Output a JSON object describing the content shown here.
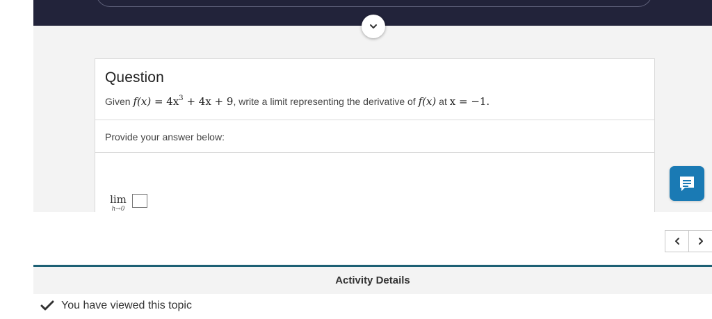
{
  "question": {
    "heading": "Question",
    "text_prefix": "Given",
    "func_name": "f(x)",
    "equals": " = 4x",
    "exponent": "3",
    "func_rest": " + 4x + 9",
    "text_middle": ", write a limit representing the derivative of",
    "func_ref": "f(x)",
    "text_at": "at",
    "point": "x = −1."
  },
  "answer": {
    "prompt": "Provide your answer below:",
    "lim_word": "lim",
    "lim_sub": "h→0"
  },
  "activity_details": {
    "title": "Activity Details",
    "viewed_text": "You have viewed this topic"
  },
  "icons": {
    "collapse": "chevron-down-icon",
    "chat": "chat-icon",
    "prev": "chevron-left-icon",
    "next": "chevron-right-icon",
    "check": "checkmark-icon"
  },
  "colors": {
    "top_bar": "#22233a",
    "chat_button": "#1a7ab4",
    "details_rule": "#1d6074"
  }
}
